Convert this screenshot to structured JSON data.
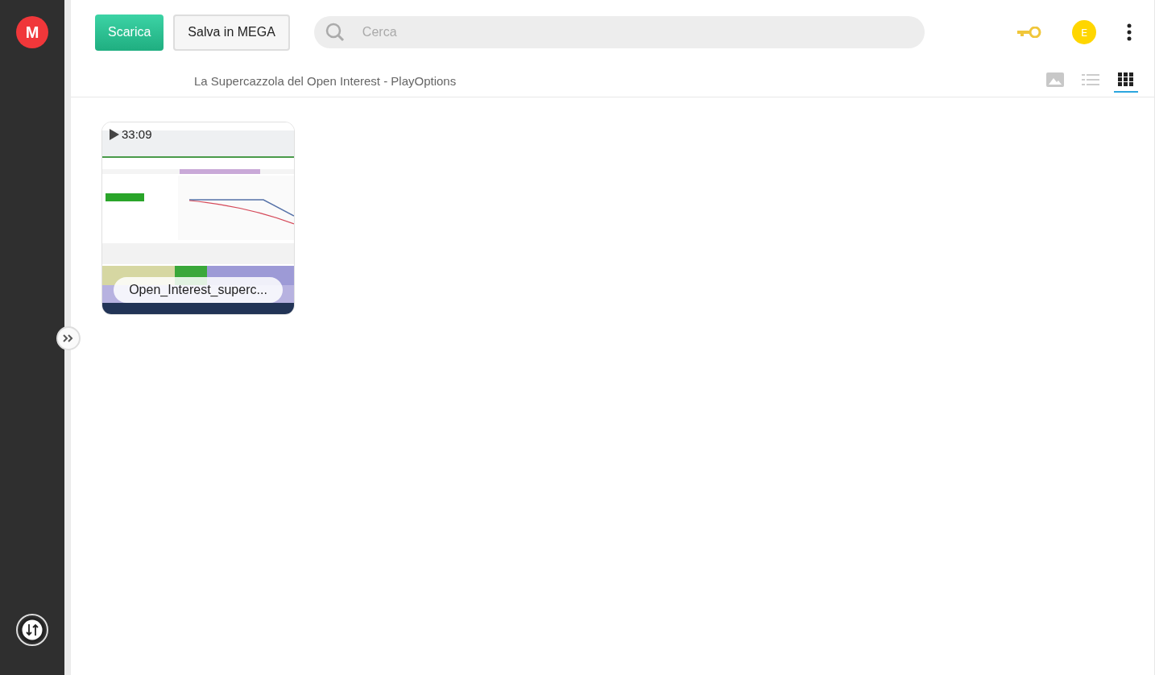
{
  "sidebar": {
    "logo": "M"
  },
  "toolbar": {
    "buttons": [
      {
        "label": "Scarica",
        "kind": "primary"
      },
      {
        "label": "Salva in MEGA",
        "kind": "secondary"
      }
    ],
    "search": {
      "placeholder": "Cerca"
    },
    "avatar": "E"
  },
  "breadcrumb": "La Supercazzola del Open Interest - PlayOptions",
  "view_modes": [
    {
      "kind": "thumbnails",
      "selected": false
    },
    {
      "kind": "list",
      "selected": false
    },
    {
      "kind": "grid",
      "selected": true
    }
  ],
  "files": [
    {
      "kind": "picture",
      "duration": "33:09",
      "name": "Open_Interest_superc..."
    }
  ]
}
